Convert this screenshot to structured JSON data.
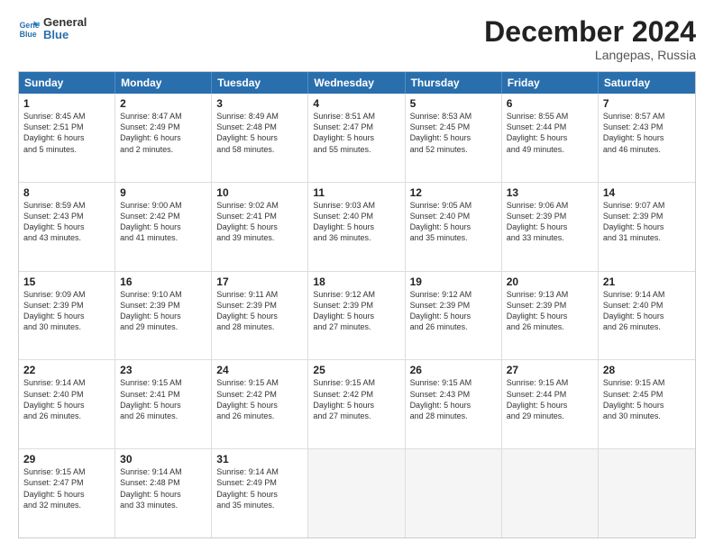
{
  "header": {
    "logo_line1": "General",
    "logo_line2": "Blue",
    "month_year": "December 2024",
    "location": "Langepas, Russia"
  },
  "days_of_week": [
    "Sunday",
    "Monday",
    "Tuesday",
    "Wednesday",
    "Thursday",
    "Friday",
    "Saturday"
  ],
  "weeks": [
    [
      {
        "day": "1",
        "lines": [
          "Sunrise: 8:45 AM",
          "Sunset: 2:51 PM",
          "Daylight: 6 hours",
          "and 5 minutes."
        ]
      },
      {
        "day": "2",
        "lines": [
          "Sunrise: 8:47 AM",
          "Sunset: 2:49 PM",
          "Daylight: 6 hours",
          "and 2 minutes."
        ]
      },
      {
        "day": "3",
        "lines": [
          "Sunrise: 8:49 AM",
          "Sunset: 2:48 PM",
          "Daylight: 5 hours",
          "and 58 minutes."
        ]
      },
      {
        "day": "4",
        "lines": [
          "Sunrise: 8:51 AM",
          "Sunset: 2:47 PM",
          "Daylight: 5 hours",
          "and 55 minutes."
        ]
      },
      {
        "day": "5",
        "lines": [
          "Sunrise: 8:53 AM",
          "Sunset: 2:45 PM",
          "Daylight: 5 hours",
          "and 52 minutes."
        ]
      },
      {
        "day": "6",
        "lines": [
          "Sunrise: 8:55 AM",
          "Sunset: 2:44 PM",
          "Daylight: 5 hours",
          "and 49 minutes."
        ]
      },
      {
        "day": "7",
        "lines": [
          "Sunrise: 8:57 AM",
          "Sunset: 2:43 PM",
          "Daylight: 5 hours",
          "and 46 minutes."
        ]
      }
    ],
    [
      {
        "day": "8",
        "lines": [
          "Sunrise: 8:59 AM",
          "Sunset: 2:43 PM",
          "Daylight: 5 hours",
          "and 43 minutes."
        ]
      },
      {
        "day": "9",
        "lines": [
          "Sunrise: 9:00 AM",
          "Sunset: 2:42 PM",
          "Daylight: 5 hours",
          "and 41 minutes."
        ]
      },
      {
        "day": "10",
        "lines": [
          "Sunrise: 9:02 AM",
          "Sunset: 2:41 PM",
          "Daylight: 5 hours",
          "and 39 minutes."
        ]
      },
      {
        "day": "11",
        "lines": [
          "Sunrise: 9:03 AM",
          "Sunset: 2:40 PM",
          "Daylight: 5 hours",
          "and 36 minutes."
        ]
      },
      {
        "day": "12",
        "lines": [
          "Sunrise: 9:05 AM",
          "Sunset: 2:40 PM",
          "Daylight: 5 hours",
          "and 35 minutes."
        ]
      },
      {
        "day": "13",
        "lines": [
          "Sunrise: 9:06 AM",
          "Sunset: 2:39 PM",
          "Daylight: 5 hours",
          "and 33 minutes."
        ]
      },
      {
        "day": "14",
        "lines": [
          "Sunrise: 9:07 AM",
          "Sunset: 2:39 PM",
          "Daylight: 5 hours",
          "and 31 minutes."
        ]
      }
    ],
    [
      {
        "day": "15",
        "lines": [
          "Sunrise: 9:09 AM",
          "Sunset: 2:39 PM",
          "Daylight: 5 hours",
          "and 30 minutes."
        ]
      },
      {
        "day": "16",
        "lines": [
          "Sunrise: 9:10 AM",
          "Sunset: 2:39 PM",
          "Daylight: 5 hours",
          "and 29 minutes."
        ]
      },
      {
        "day": "17",
        "lines": [
          "Sunrise: 9:11 AM",
          "Sunset: 2:39 PM",
          "Daylight: 5 hours",
          "and 28 minutes."
        ]
      },
      {
        "day": "18",
        "lines": [
          "Sunrise: 9:12 AM",
          "Sunset: 2:39 PM",
          "Daylight: 5 hours",
          "and 27 minutes."
        ]
      },
      {
        "day": "19",
        "lines": [
          "Sunrise: 9:12 AM",
          "Sunset: 2:39 PM",
          "Daylight: 5 hours",
          "and 26 minutes."
        ]
      },
      {
        "day": "20",
        "lines": [
          "Sunrise: 9:13 AM",
          "Sunset: 2:39 PM",
          "Daylight: 5 hours",
          "and 26 minutes."
        ]
      },
      {
        "day": "21",
        "lines": [
          "Sunrise: 9:14 AM",
          "Sunset: 2:40 PM",
          "Daylight: 5 hours",
          "and 26 minutes."
        ]
      }
    ],
    [
      {
        "day": "22",
        "lines": [
          "Sunrise: 9:14 AM",
          "Sunset: 2:40 PM",
          "Daylight: 5 hours",
          "and 26 minutes."
        ]
      },
      {
        "day": "23",
        "lines": [
          "Sunrise: 9:15 AM",
          "Sunset: 2:41 PM",
          "Daylight: 5 hours",
          "and 26 minutes."
        ]
      },
      {
        "day": "24",
        "lines": [
          "Sunrise: 9:15 AM",
          "Sunset: 2:42 PM",
          "Daylight: 5 hours",
          "and 26 minutes."
        ]
      },
      {
        "day": "25",
        "lines": [
          "Sunrise: 9:15 AM",
          "Sunset: 2:42 PM",
          "Daylight: 5 hours",
          "and 27 minutes."
        ]
      },
      {
        "day": "26",
        "lines": [
          "Sunrise: 9:15 AM",
          "Sunset: 2:43 PM",
          "Daylight: 5 hours",
          "and 28 minutes."
        ]
      },
      {
        "day": "27",
        "lines": [
          "Sunrise: 9:15 AM",
          "Sunset: 2:44 PM",
          "Daylight: 5 hours",
          "and 29 minutes."
        ]
      },
      {
        "day": "28",
        "lines": [
          "Sunrise: 9:15 AM",
          "Sunset: 2:45 PM",
          "Daylight: 5 hours",
          "and 30 minutes."
        ]
      }
    ],
    [
      {
        "day": "29",
        "lines": [
          "Sunrise: 9:15 AM",
          "Sunset: 2:47 PM",
          "Daylight: 5 hours",
          "and 32 minutes."
        ]
      },
      {
        "day": "30",
        "lines": [
          "Sunrise: 9:14 AM",
          "Sunset: 2:48 PM",
          "Daylight: 5 hours",
          "and 33 minutes."
        ]
      },
      {
        "day": "31",
        "lines": [
          "Sunrise: 9:14 AM",
          "Sunset: 2:49 PM",
          "Daylight: 5 hours",
          "and 35 minutes."
        ]
      },
      {
        "day": "",
        "lines": []
      },
      {
        "day": "",
        "lines": []
      },
      {
        "day": "",
        "lines": []
      },
      {
        "day": "",
        "lines": []
      }
    ]
  ]
}
